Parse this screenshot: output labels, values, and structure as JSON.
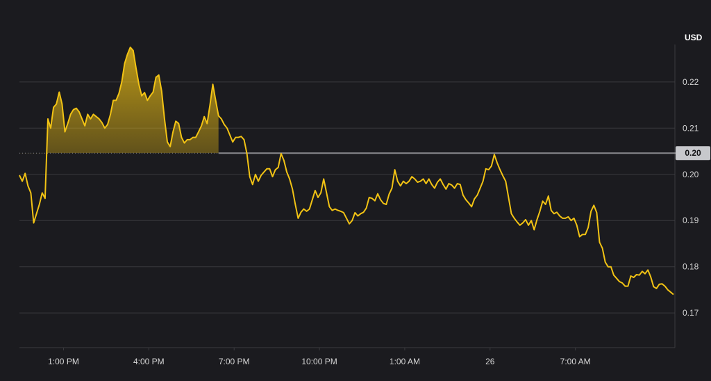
{
  "chart_data": {
    "type": "line",
    "unit": "USD",
    "ylim": [
      0.1625,
      0.2275
    ],
    "y_ticks": [
      "0.17",
      "0.18",
      "0.19",
      "0.20",
      "0.21",
      "0.22"
    ],
    "x_ticks": [
      "1:00 PM",
      "4:00 PM",
      "7:00 PM",
      "10:00 PM",
      "1:00 AM",
      "26",
      "7:00 AM"
    ],
    "x_tick_hours": [
      1,
      4,
      7,
      10,
      13,
      16,
      19
    ],
    "xlim_hours": [
      -0.55,
      22.5
    ],
    "grid": true,
    "reference": {
      "value": 0.2046,
      "label": "0.20"
    },
    "series": [
      {
        "color": "#f2c314",
        "x_hours": [
          -0.55,
          -0.45,
          -0.35,
          -0.25,
          -0.15,
          -0.05,
          0.05,
          0.15,
          0.25,
          0.35,
          0.45,
          0.55,
          0.65,
          0.75,
          0.85,
          0.95,
          1.05,
          1.15,
          1.25,
          1.35,
          1.45,
          1.55,
          1.65,
          1.75,
          1.85,
          1.95,
          2.05,
          2.15,
          2.25,
          2.35,
          2.45,
          2.55,
          2.65,
          2.75,
          2.85,
          2.95,
          3.05,
          3.15,
          3.25,
          3.35,
          3.45,
          3.55,
          3.65,
          3.75,
          3.85,
          3.95,
          4.05,
          4.15,
          4.25,
          4.35,
          4.45,
          4.55,
          4.65,
          4.75,
          4.85,
          4.95,
          5.05,
          5.15,
          5.25,
          5.35,
          5.45,
          5.55,
          5.65,
          5.75,
          5.85,
          5.95,
          6.05,
          6.15,
          6.25,
          6.35,
          6.45,
          6.55,
          6.65,
          6.75,
          6.85,
          6.95,
          7.05,
          7.15,
          7.25,
          7.35,
          7.45,
          7.55,
          7.65,
          7.75,
          7.85,
          7.95,
          8.05,
          8.15,
          8.25,
          8.35,
          8.45,
          8.55,
          8.65,
          8.75,
          8.85,
          8.95,
          9.05,
          9.15,
          9.25,
          9.35,
          9.45,
          9.55,
          9.65,
          9.75,
          9.85,
          9.95,
          10.05,
          10.15,
          10.25,
          10.35,
          10.45,
          10.55,
          10.65,
          10.75,
          10.85,
          10.95,
          11.05,
          11.15,
          11.25,
          11.35,
          11.45,
          11.55,
          11.65,
          11.75,
          11.85,
          11.95,
          12.05,
          12.15,
          12.25,
          12.35,
          12.45,
          12.55,
          12.65,
          12.75,
          12.85,
          12.95,
          13.05,
          13.15,
          13.25,
          13.35,
          13.45,
          13.55,
          13.65,
          13.75,
          13.85,
          13.95,
          14.05,
          14.15,
          14.25,
          14.35,
          14.45,
          14.55,
          14.65,
          14.75,
          14.85,
          14.95,
          15.05,
          15.15,
          15.25,
          15.35,
          15.45,
          15.55,
          15.65,
          15.75,
          15.85,
          15.95,
          16.05,
          16.15,
          16.25,
          16.35,
          16.45,
          16.55,
          16.65,
          16.75,
          16.85,
          16.95,
          17.05,
          17.15,
          17.25,
          17.35,
          17.45,
          17.55,
          17.65,
          17.75,
          17.85,
          17.95,
          18.05,
          18.15,
          18.25,
          18.35,
          18.45,
          18.55,
          18.65,
          18.75,
          18.85,
          18.95,
          19.05,
          19.15,
          19.25,
          19.35,
          19.45,
          19.55,
          19.65,
          19.75,
          19.85,
          19.95,
          20.05,
          20.15,
          20.25,
          20.35,
          20.45,
          20.55,
          20.65,
          20.75,
          20.85,
          20.95,
          21.05,
          21.15,
          21.25,
          21.35,
          21.45,
          21.55,
          21.65,
          21.75,
          21.85,
          21.95,
          22.05,
          22.15,
          22.25,
          22.35,
          22.45
        ],
        "values": [
          0.1998,
          0.1985,
          0.2002,
          0.1975,
          0.196,
          0.1895,
          0.1915,
          0.1935,
          0.196,
          0.1948,
          0.212,
          0.21,
          0.2145,
          0.2152,
          0.2178,
          0.2152,
          0.2092,
          0.211,
          0.213,
          0.214,
          0.2143,
          0.2135,
          0.212,
          0.2105,
          0.213,
          0.212,
          0.213,
          0.2125,
          0.212,
          0.2112,
          0.21,
          0.2108,
          0.213,
          0.216,
          0.216,
          0.2175,
          0.22,
          0.224,
          0.226,
          0.2275,
          0.2268,
          0.223,
          0.2195,
          0.217,
          0.2177,
          0.216,
          0.217,
          0.2178,
          0.221,
          0.2215,
          0.218,
          0.212,
          0.207,
          0.206,
          0.2092,
          0.2115,
          0.211,
          0.208,
          0.2068,
          0.2075,
          0.2075,
          0.208,
          0.208,
          0.2092,
          0.2105,
          0.2125,
          0.211,
          0.215,
          0.2195,
          0.216,
          0.2127,
          0.212,
          0.2108,
          0.21,
          0.2085,
          0.207,
          0.208,
          0.208,
          0.2082,
          0.2075,
          0.2045,
          0.1995,
          0.1978,
          0.2,
          0.1985,
          0.1998,
          0.2005,
          0.2012,
          0.2012,
          0.1995,
          0.201,
          0.2015,
          0.2045,
          0.203,
          0.2005,
          0.199,
          0.1968,
          0.1935,
          0.1905,
          0.1918,
          0.1925,
          0.192,
          0.1925,
          0.1945,
          0.1965,
          0.195,
          0.196,
          0.199,
          0.196,
          0.193,
          0.1922,
          0.1925,
          0.1922,
          0.192,
          0.1917,
          0.1905,
          0.1893,
          0.19,
          0.1917,
          0.191,
          0.1915,
          0.1918,
          0.1927,
          0.195,
          0.1948,
          0.1943,
          0.1958,
          0.1945,
          0.1937,
          0.1935,
          0.1957,
          0.197,
          0.201,
          0.1985,
          0.1975,
          0.1985,
          0.198,
          0.1985,
          0.1995,
          0.199,
          0.1983,
          0.1985,
          0.199,
          0.198,
          0.199,
          0.1978,
          0.197,
          0.1983,
          0.199,
          0.1978,
          0.1968,
          0.198,
          0.1977,
          0.197,
          0.198,
          0.1978,
          0.1955,
          0.1945,
          0.1938,
          0.193,
          0.1947,
          0.1955,
          0.197,
          0.1985,
          0.2012,
          0.201,
          0.2018,
          0.2043,
          0.2025,
          0.201,
          0.1997,
          0.1985,
          0.195,
          0.1915,
          0.1905,
          0.1897,
          0.189,
          0.1895,
          0.1902,
          0.189,
          0.19,
          0.188,
          0.1902,
          0.192,
          0.1942,
          0.1935,
          0.1953,
          0.1922,
          0.1915,
          0.1918,
          0.191,
          0.1905,
          0.1905,
          0.1908,
          0.19,
          0.1905,
          0.189,
          0.1865,
          0.187,
          0.187,
          0.1885,
          0.192,
          0.1933,
          0.1917,
          0.1853,
          0.184,
          0.181,
          0.18,
          0.18,
          0.1782,
          0.1775,
          0.1768,
          0.1765,
          0.1758,
          0.1758,
          0.178,
          0.1777,
          0.1783,
          0.1782,
          0.179,
          0.1785,
          0.1793,
          0.1778,
          0.1757,
          0.1753,
          0.1762,
          0.1763,
          0.1758,
          0.175,
          0.1745,
          0.174,
          0.1735,
          0.174,
          0.174,
          0.1745,
          0.1762,
          0.1765,
          0.1772,
          0.178,
          0.1782,
          0.1785,
          0.1792,
          0.1793,
          0.1798,
          0.179,
          0.1785,
          0.1778,
          0.178,
          0.179,
          0.1818,
          0.1808,
          0.18,
          0.1798,
          0.18,
          0.1795,
          0.1785,
          0.1772,
          0.177,
          0.1773,
          0.1772,
          0.177,
          0.177,
          0.1762,
          0.1755,
          0.1758,
          0.1755,
          0.1757,
          0.1762
        ]
      }
    ]
  }
}
